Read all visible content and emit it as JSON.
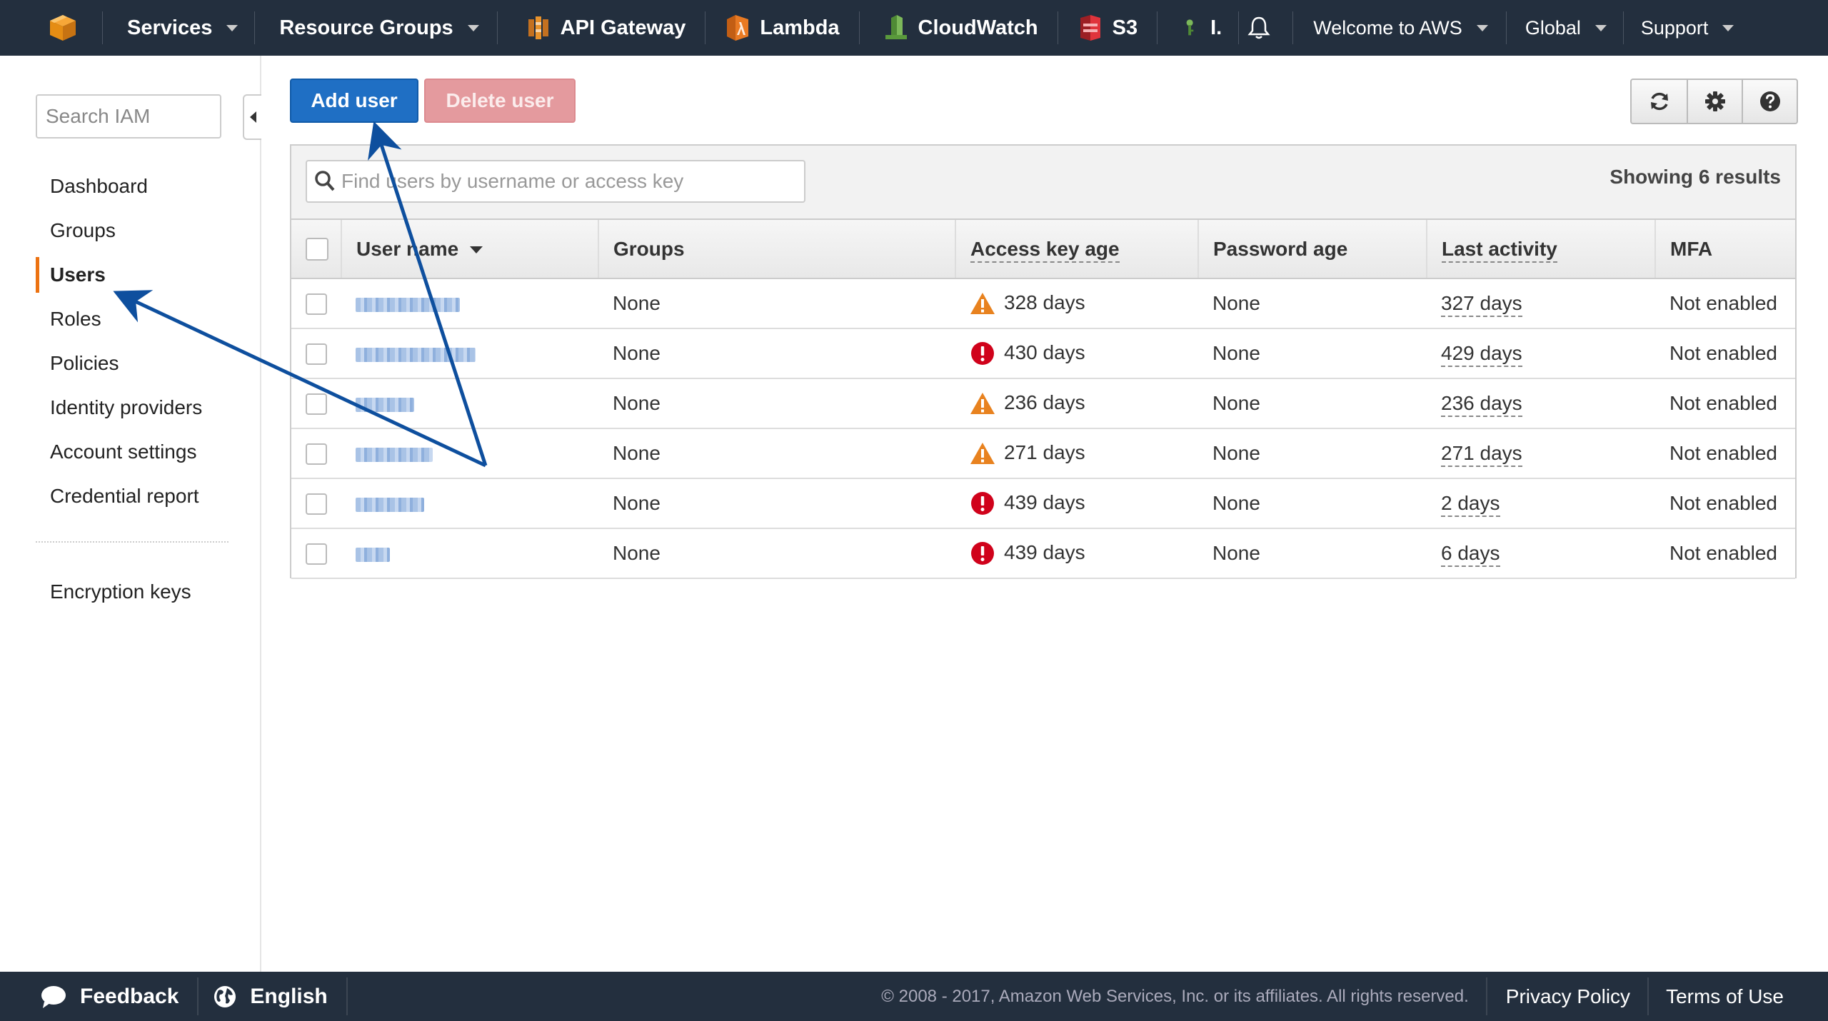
{
  "topnav": {
    "services": "Services",
    "resource_groups": "Resource Groups",
    "shortcuts": [
      {
        "label": "API Gateway",
        "icon": "api-gateway-icon",
        "color": "#e0892a"
      },
      {
        "label": "Lambda",
        "icon": "lambda-icon",
        "color": "#e07b24"
      },
      {
        "label": "CloudWatch",
        "icon": "cloudwatch-icon",
        "color": "#6aa84f"
      },
      {
        "label": "S3",
        "icon": "s3-icon",
        "color": "#d9363e"
      },
      {
        "label": "I.",
        "icon": "iam-icon",
        "color": "#6aa84f"
      }
    ],
    "account": "Welcome to AWS",
    "region": "Global",
    "support": "Support"
  },
  "sidebar": {
    "search_placeholder": "Search IAM",
    "items": [
      {
        "label": "Dashboard",
        "active": false
      },
      {
        "label": "Groups",
        "active": false
      },
      {
        "label": "Users",
        "active": true
      },
      {
        "label": "Roles",
        "active": false
      },
      {
        "label": "Policies",
        "active": false
      },
      {
        "label": "Identity providers",
        "active": false
      },
      {
        "label": "Account settings",
        "active": false
      },
      {
        "label": "Credential report",
        "active": false
      }
    ],
    "encryption_keys": "Encryption keys"
  },
  "toolbar": {
    "add_user": "Add user",
    "delete_user": "Delete user"
  },
  "users_table": {
    "filter_placeholder": "Find users by username or access key",
    "result_count": "Showing 6 results",
    "columns": [
      "User name",
      "Groups",
      "Access key age",
      "Password age",
      "Last activity",
      "MFA"
    ],
    "rows": [
      {
        "groups": "None",
        "access_key_age": "328 days",
        "key_status": "warning",
        "password_age": "None",
        "last_activity": "327 days",
        "mfa": "Not enabled"
      },
      {
        "groups": "None",
        "access_key_age": "430 days",
        "key_status": "critical",
        "password_age": "None",
        "last_activity": "429 days",
        "mfa": "Not enabled"
      },
      {
        "groups": "None",
        "access_key_age": "236 days",
        "key_status": "warning",
        "password_age": "None",
        "last_activity": "236 days",
        "mfa": "Not enabled"
      },
      {
        "groups": "None",
        "access_key_age": "271 days",
        "key_status": "warning",
        "password_age": "None",
        "last_activity": "271 days",
        "mfa": "Not enabled"
      },
      {
        "groups": "None",
        "access_key_age": "439 days",
        "key_status": "critical",
        "password_age": "None",
        "last_activity": "2 days",
        "mfa": "Not enabled"
      },
      {
        "groups": "None",
        "access_key_age": "439 days",
        "key_status": "critical",
        "password_age": "None",
        "last_activity": "6 days",
        "mfa": "Not enabled"
      }
    ]
  },
  "footer": {
    "feedback": "Feedback",
    "language": "English",
    "copyright": "© 2008 - 2017, Amazon Web Services, Inc. or its affiliates. All rights reserved.",
    "privacy": "Privacy Policy",
    "terms": "Terms of Use"
  },
  "colors": {
    "nav_bg": "#232f3e",
    "primary_button": "#1f6fc4",
    "danger_button_disabled": "#e49a9e",
    "warning": "#e8821f",
    "critical": "#d0021b",
    "active_marker": "#ec7211",
    "annotation_arrow": "#0e4f9e"
  }
}
